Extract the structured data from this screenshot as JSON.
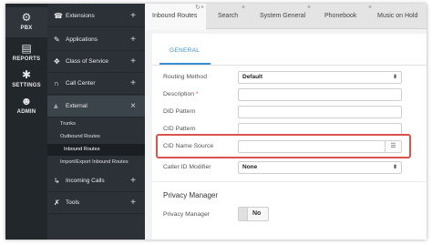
{
  "rail": {
    "items": [
      {
        "label": "PBX",
        "icon": "gear-icon",
        "glyph": "⚙"
      },
      {
        "label": "REPORTS",
        "icon": "document-icon",
        "glyph": "▤"
      },
      {
        "label": "SETTINGS",
        "icon": "cogs-icon",
        "glyph": "⚙"
      },
      {
        "label": "ADMIN",
        "icon": "users-icon",
        "glyph": "👥"
      }
    ]
  },
  "nav": {
    "extensions": "Extensions",
    "applications": "Applications",
    "class_of_service": "Class of Service",
    "call_center": "Call Center",
    "external": "External",
    "external_sub": [
      "Trunks",
      "Outbound Routes",
      "Inbound Routes",
      "Import/Export Inbound Routes"
    ],
    "incoming_calls": "Incoming Calls",
    "tools": "Tools",
    "plus": "+",
    "close": "×"
  },
  "tabs": [
    "Inbound Routes",
    "Search",
    "System General",
    "Phonebook",
    "Music on Hold"
  ],
  "panel": {
    "subtab": "GENERAL",
    "routing_method_label": "Routing Method",
    "routing_method_value": "Default",
    "description_label": "Description",
    "required_mark": "*",
    "did_pattern_label": "DID Pattern",
    "cid_pattern_label": "CID Pattern",
    "cid_name_source_label": "CID Name Source",
    "caller_id_modifier_label": "Caller ID Modifier",
    "caller_id_modifier_value": "None",
    "privacy_section": "Privacy Manager",
    "privacy_label": "Privacy Manager",
    "privacy_value": "No"
  },
  "colors": {
    "accent": "#3a8fd0",
    "highlight": "#d9534f",
    "sidebar": "#2b3137"
  }
}
